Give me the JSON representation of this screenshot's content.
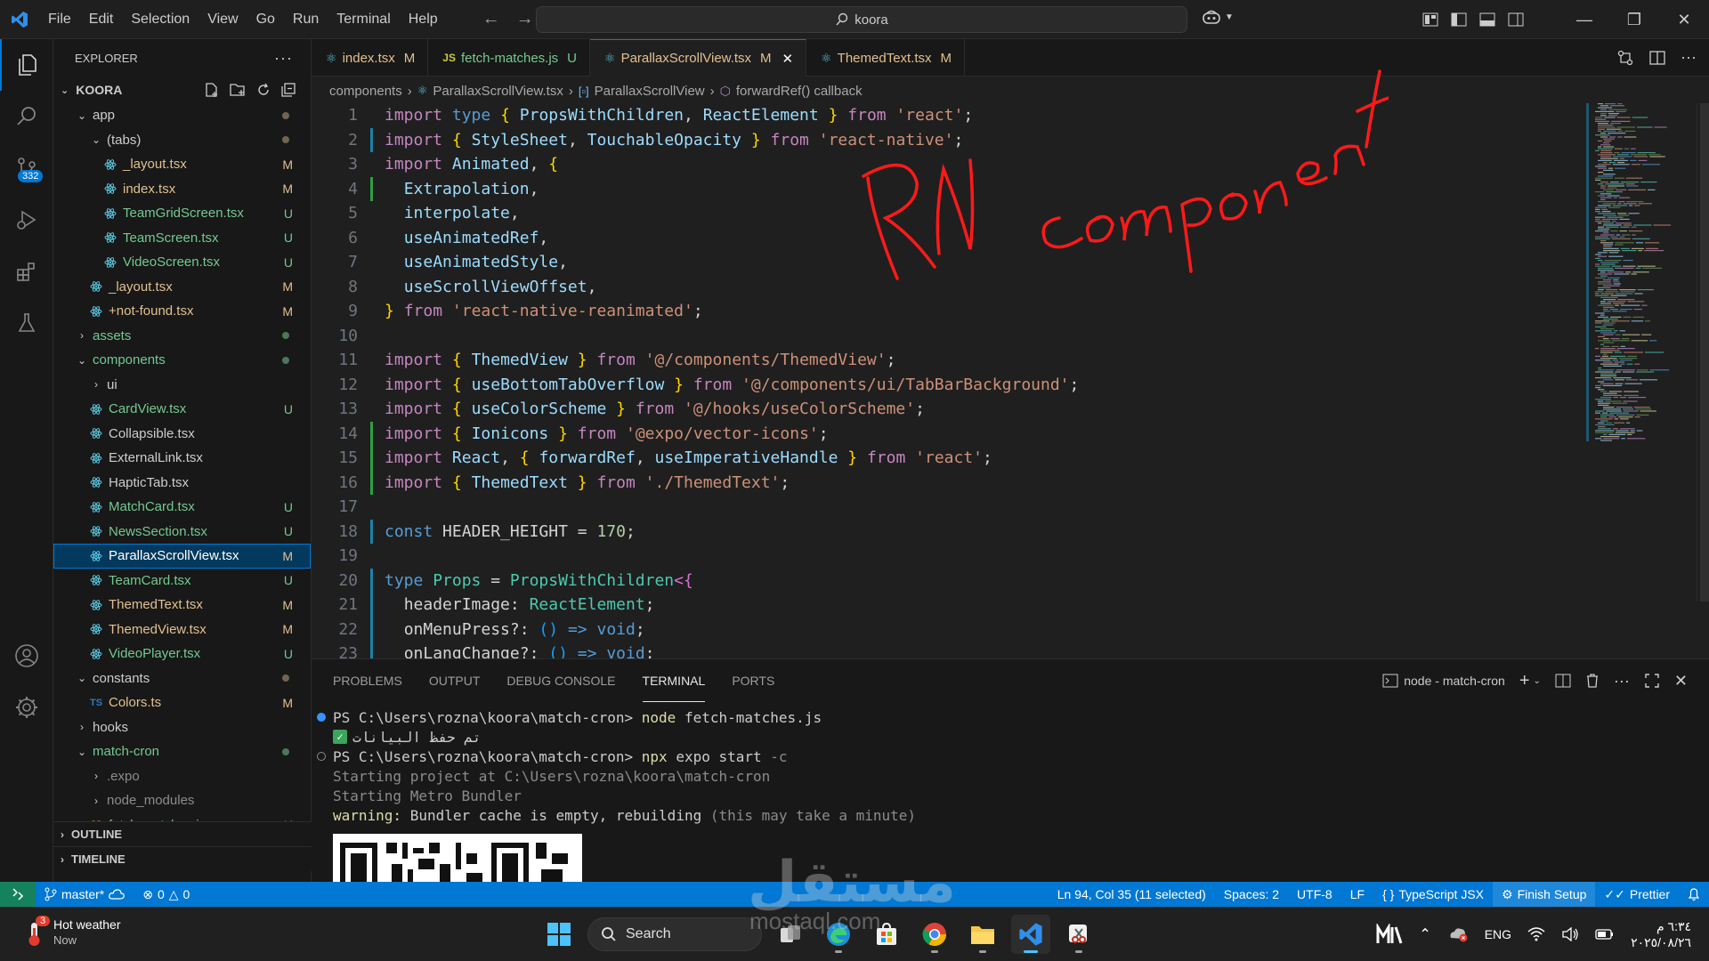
{
  "menu": [
    "File",
    "Edit",
    "Selection",
    "View",
    "Go",
    "Run",
    "Terminal",
    "Help"
  ],
  "search": {
    "text": "koora"
  },
  "explorer": {
    "title": "EXPLORER",
    "root": "KOORA",
    "items": [
      {
        "label": "app",
        "indent": 1,
        "type": "folder-open",
        "status": "dot-mod"
      },
      {
        "label": "(tabs)",
        "indent": 2,
        "type": "folder-open",
        "status": "dot-mod"
      },
      {
        "label": "_layout.tsx",
        "indent": 3,
        "type": "react",
        "status": "M",
        "tone": "mod"
      },
      {
        "label": "index.tsx",
        "indent": 3,
        "type": "react",
        "status": "M",
        "tone": "mod"
      },
      {
        "label": "TeamGridScreen.tsx",
        "indent": 3,
        "type": "react",
        "status": "U",
        "tone": "unt"
      },
      {
        "label": "TeamScreen.tsx",
        "indent": 3,
        "type": "react",
        "status": "U",
        "tone": "unt"
      },
      {
        "label": "VideoScreen.tsx",
        "indent": 3,
        "type": "react",
        "status": "U",
        "tone": "unt"
      },
      {
        "label": "_layout.tsx",
        "indent": 2,
        "type": "react",
        "status": "M",
        "tone": "mod"
      },
      {
        "label": "+not-found.tsx",
        "indent": 2,
        "type": "react",
        "status": "M",
        "tone": "mod"
      },
      {
        "label": "assets",
        "indent": 1,
        "type": "folder",
        "status": "dot-unt",
        "tone": "unt"
      },
      {
        "label": "components",
        "indent": 1,
        "type": "folder-open",
        "status": "dot-unt",
        "tone": "unt"
      },
      {
        "label": "ui",
        "indent": 2,
        "type": "folder",
        "status": ""
      },
      {
        "label": "CardView.tsx",
        "indent": 2,
        "type": "react",
        "status": "U",
        "tone": "unt"
      },
      {
        "label": "Collapsible.tsx",
        "indent": 2,
        "type": "react",
        "status": ""
      },
      {
        "label": "ExternalLink.tsx",
        "indent": 2,
        "type": "react",
        "status": ""
      },
      {
        "label": "HapticTab.tsx",
        "indent": 2,
        "type": "react",
        "status": ""
      },
      {
        "label": "MatchCard.tsx",
        "indent": 2,
        "type": "react",
        "status": "U",
        "tone": "unt"
      },
      {
        "label": "NewsSection.tsx",
        "indent": 2,
        "type": "react",
        "status": "U",
        "tone": "unt"
      },
      {
        "label": "ParallaxScrollView.tsx",
        "indent": 2,
        "type": "react",
        "status": "M",
        "tone": "sel"
      },
      {
        "label": "TeamCard.tsx",
        "indent": 2,
        "type": "react",
        "status": "U",
        "tone": "unt"
      },
      {
        "label": "ThemedText.tsx",
        "indent": 2,
        "type": "react",
        "status": "M",
        "tone": "mod"
      },
      {
        "label": "ThemedView.tsx",
        "indent": 2,
        "type": "react",
        "status": "M",
        "tone": "mod"
      },
      {
        "label": "VideoPlayer.tsx",
        "indent": 2,
        "type": "react",
        "status": "U",
        "tone": "unt"
      },
      {
        "label": "constants",
        "indent": 1,
        "type": "folder-open",
        "status": "dot-mod"
      },
      {
        "label": "Colors.ts",
        "indent": 2,
        "type": "ts",
        "status": "M",
        "tone": "mod"
      },
      {
        "label": "hooks",
        "indent": 1,
        "type": "folder",
        "status": ""
      },
      {
        "label": "match-cron",
        "indent": 1,
        "type": "folder-open",
        "status": "dot-unt",
        "tone": "unt"
      },
      {
        "label": ".expo",
        "indent": 2,
        "type": "folder",
        "status": "",
        "tone": "dim"
      },
      {
        "label": "node_modules",
        "indent": 2,
        "type": "folder",
        "status": "",
        "tone": "dim"
      },
      {
        "label": "fetch-matches.js",
        "indent": 2,
        "type": "js",
        "status": "U",
        "tone": "unt"
      }
    ],
    "outline": "OUTLINE",
    "timeline": "TIMELINE"
  },
  "activity": {
    "scm_badge": "332"
  },
  "tabs": [
    {
      "icon": "react",
      "label": "index.tsx",
      "status": "M",
      "tone": "mod"
    },
    {
      "icon": "js",
      "label": "fetch-matches.js",
      "status": "U",
      "tone": "unt"
    },
    {
      "icon": "react",
      "label": "ParallaxScrollView.tsx",
      "status": "M",
      "tone": "mod",
      "active": true
    },
    {
      "icon": "react",
      "label": "ThemedText.tsx",
      "status": "M",
      "tone": "mod"
    }
  ],
  "breadcrumb": [
    "components",
    "ParallaxScrollView.tsx",
    "ParallaxScrollView",
    "forwardRef() callback"
  ],
  "annotation": "RN component",
  "code": {
    "line_numbers": [
      "1",
      "2",
      "3",
      "4",
      "5",
      "6",
      "7",
      "8",
      "9",
      "10",
      "11",
      "12",
      "13",
      "14",
      "15",
      "16",
      "17",
      "18",
      "19",
      "20",
      "21",
      "22",
      "23"
    ],
    "gutter": [
      "",
      "mod",
      "",
      "add",
      "",
      "",
      "",
      "",
      "",
      "",
      "",
      "",
      "",
      "add",
      "add",
      "add",
      "",
      "mod",
      "",
      "mod",
      "mod",
      "mod",
      "mod"
    ]
  },
  "panel": {
    "tabs": [
      "PROBLEMS",
      "OUTPUT",
      "DEBUG CONSOLE",
      "TERMINAL",
      "PORTS"
    ],
    "active_tab": "TERMINAL",
    "terminal_name": "node - match-cron",
    "lines": [
      {
        "prompt": "PS C:\\Users\\rozna\\koora\\match-cron> ",
        "cmd": "node",
        "rest": " fetch-matches.js",
        "mark": "blue"
      },
      {
        "text": "تم حفظ البيانات",
        "check": true
      },
      {
        "prompt": "PS C:\\Users\\rozna\\koora\\match-cron> ",
        "cmd": "npx",
        "rest": " expo start ",
        "flag": "-c",
        "mark": "hollow"
      },
      {
        "text": "Starting project at C:\\Users\\rozna\\koora\\match-cron",
        "dim": true
      },
      {
        "text": "Starting Metro Bundler",
        "dim": true
      },
      {
        "warn": "warning:",
        "text": " Bundler cache is empty, rebuilding ",
        "tail": "(this may take a minute)"
      }
    ]
  },
  "status": {
    "branch": "master*",
    "errors": "0",
    "warnings": "0",
    "position": "Ln 94, Col 35 (11 selected)",
    "spaces": "Spaces: 2",
    "encoding": "UTF-8",
    "eol": "LF",
    "language": "TypeScript JSX",
    "finish": "Finish Setup",
    "prettier": "Prettier"
  },
  "taskbar": {
    "weather_title": "Hot weather",
    "weather_sub": "Now",
    "weather_badge": "3",
    "search": "Search",
    "lang": "ENG",
    "time": "٦:٣٤ م",
    "date": "٢٠٢٥/٠٨/٢٦"
  },
  "watermark": {
    "main": "مستقل",
    "sub": "mostaql.com"
  },
  "colors": {
    "accent": "#0078d4",
    "modified": "#e2c08d",
    "untracked": "#73c991",
    "annotation": "#ff1a1a"
  }
}
